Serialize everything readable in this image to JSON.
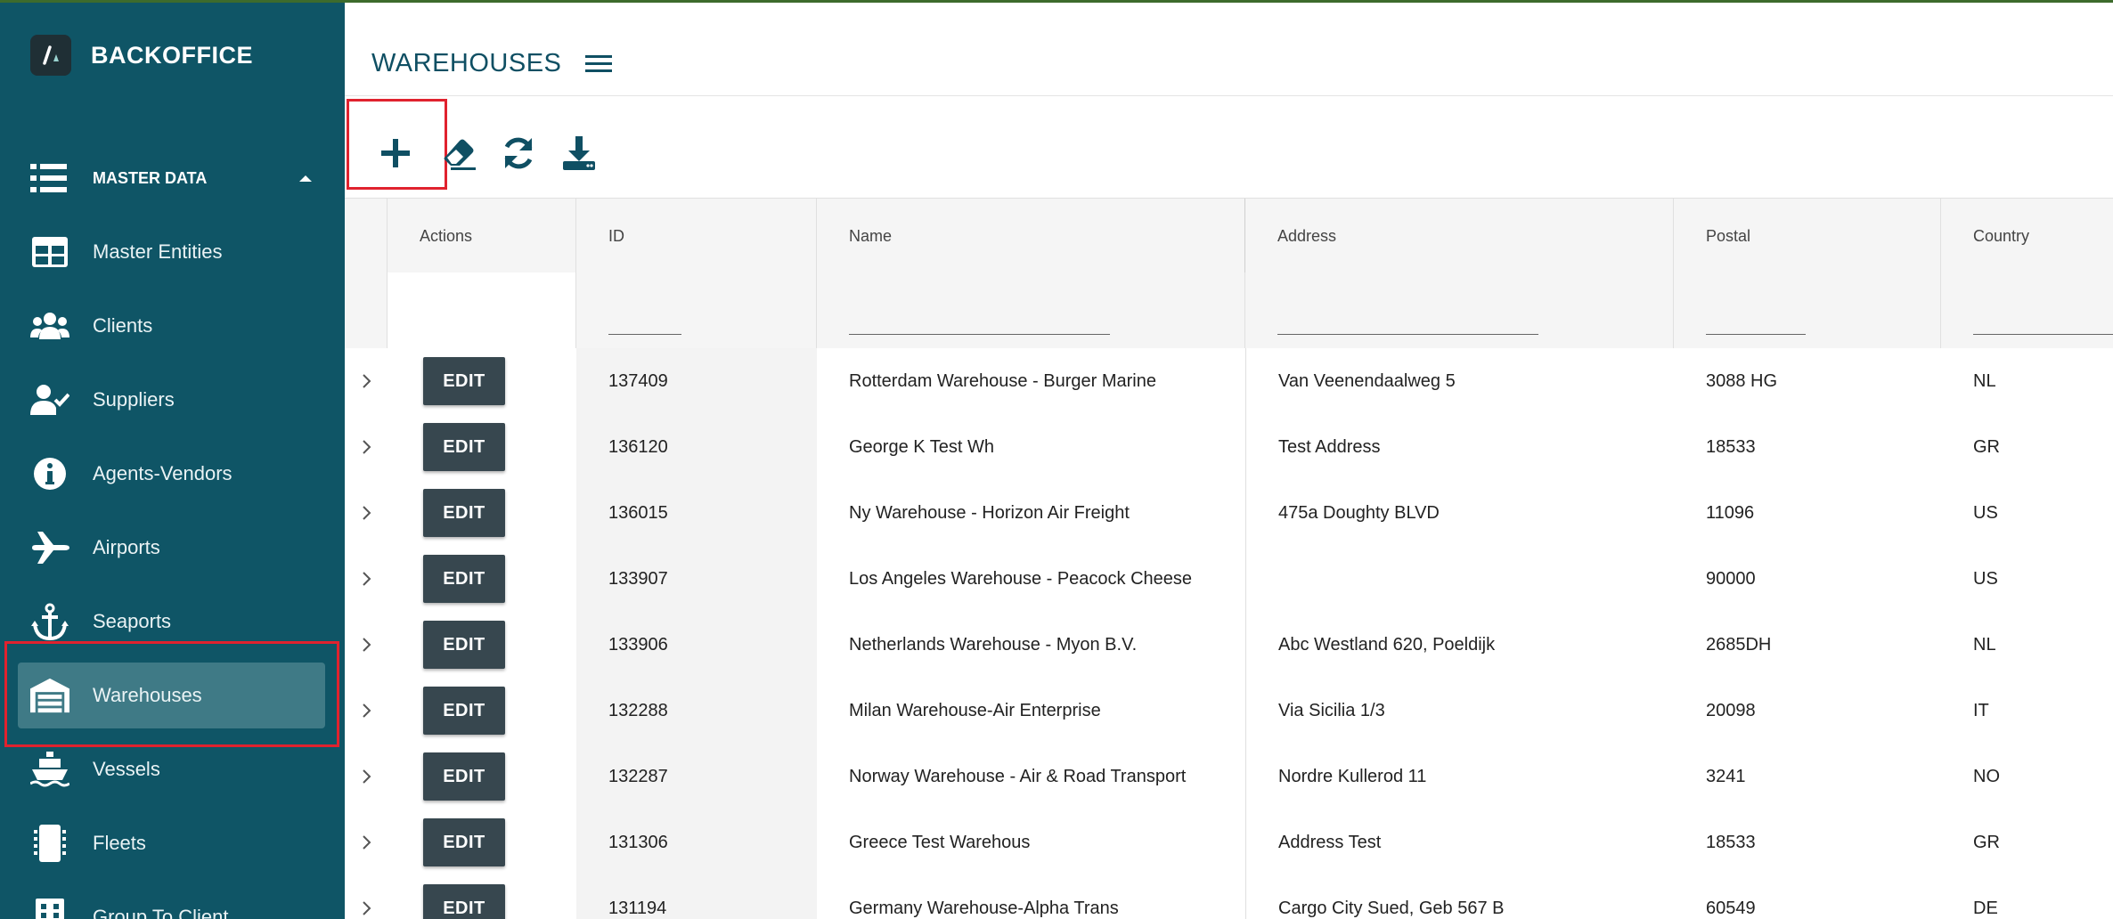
{
  "brand": {
    "name": "BACKOFFICE"
  },
  "sidebar": {
    "section": "MASTER DATA",
    "items": [
      {
        "label": "Master Entities",
        "icon": "table-icon"
      },
      {
        "label": "Clients",
        "icon": "users-group-icon"
      },
      {
        "label": "Suppliers",
        "icon": "user-check-icon"
      },
      {
        "label": "Agents-Vendors",
        "icon": "info-circle-icon"
      },
      {
        "label": "Airports",
        "icon": "plane-icon"
      },
      {
        "label": "Seaports",
        "icon": "anchor-icon"
      },
      {
        "label": "Warehouses",
        "icon": "warehouse-icon",
        "active": true
      },
      {
        "label": "Vessels",
        "icon": "ship-icon"
      },
      {
        "label": "Fleets",
        "icon": "fleet-icon"
      },
      {
        "label": "Group To Client",
        "icon": "building-icon"
      }
    ]
  },
  "header": {
    "title": "WAREHOUSES"
  },
  "toolbar": {
    "add": "plus-icon",
    "clear": "eraser-icon",
    "refresh": "refresh-icon",
    "download": "download-icon"
  },
  "table": {
    "columns": [
      "Actions",
      "ID",
      "Name",
      "Address",
      "Postal",
      "Country"
    ],
    "edit_label": "EDIT",
    "rows": [
      {
        "id": "137409",
        "name": "Rotterdam Warehouse - Burger Marine",
        "address": "Van Veenendaalweg 5",
        "postal": "3088 HG",
        "country": "NL"
      },
      {
        "id": "136120",
        "name": "George K Test Wh",
        "address": "Test Address",
        "postal": "18533",
        "country": "GR"
      },
      {
        "id": "136015",
        "name": "Ny Warehouse - Horizon Air Freight",
        "address": "475a Doughty BLVD",
        "postal": "11096",
        "country": "US"
      },
      {
        "id": "133907",
        "name": "Los Angeles Warehouse - Peacock Cheese",
        "address": "",
        "postal": "90000",
        "country": "US"
      },
      {
        "id": "133906",
        "name": "Netherlands Warehouse - Myon B.V.",
        "address": "Abc Westland 620, Poeldijk",
        "postal": "2685DH",
        "country": "NL"
      },
      {
        "id": "132288",
        "name": "Milan Warehouse-Air Enterprise",
        "address": "Via Sicilia 1/3",
        "postal": "20098",
        "country": "IT"
      },
      {
        "id": "132287",
        "name": "Norway Warehouse - Air & Road Transport",
        "address": "Nordre Kullerod 11",
        "postal": "3241",
        "country": "NO"
      },
      {
        "id": "131306",
        "name": "Greece Test Warehous",
        "address": "Address Test",
        "postal": "18533",
        "country": "GR"
      },
      {
        "id": "131194",
        "name": "Germany Warehouse-Alpha Trans",
        "address": "Cargo City Sued, Geb 567 B",
        "postal": "60549",
        "country": "DE"
      }
    ]
  }
}
